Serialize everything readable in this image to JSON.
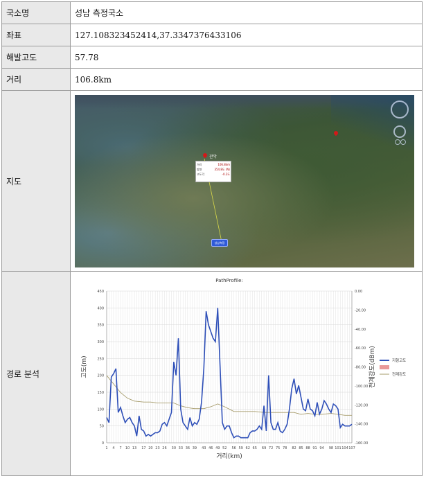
{
  "rows": {
    "station": {
      "label": "국소명",
      "value": "성남 측정국소"
    },
    "coords": {
      "label": "좌표",
      "value": "127.108323452414,37.3347376433106"
    },
    "altitude": {
      "label": "해발고도",
      "value": "57.78"
    },
    "distance": {
      "label": "거리",
      "value": "106.8km"
    },
    "map": {
      "label": "지도"
    },
    "path": {
      "label": "경로 분석"
    }
  },
  "map": {
    "infobox": [
      {
        "k": "거리",
        "v": "106.8km"
      },
      {
        "k": "방향",
        "v": "354.8도 (N)"
      },
      {
        "k": "고도각",
        "v": "-0.2도"
      }
    ],
    "pin_label": "관악",
    "marker_label": "성남측정"
  },
  "chart_data": {
    "type": "line",
    "title": "PathProfile:",
    "xlabel": "거리(km)",
    "ylabel_left": "고도(m)",
    "ylabel_right": "전계강도(dBm)",
    "ylim_left": [
      0,
      450
    ],
    "ylim_right": [
      -160,
      0
    ],
    "yticks_left": [
      "0",
      "50",
      "100",
      "150",
      "200",
      "250",
      "300",
      "350",
      "400",
      "450"
    ],
    "yticks_right": [
      "0.00",
      "-20.00",
      "-40.00",
      "-60.00",
      "-80.00",
      "-100.00",
      "-120.00",
      "-140.00",
      "-160.00"
    ],
    "xticks": [
      "1",
      "4",
      "7",
      "10",
      "13",
      "17",
      "20",
      "23",
      "26",
      "30",
      "33",
      "36",
      "39",
      "43",
      "46",
      "49",
      "52",
      "56",
      "59",
      "62",
      "65",
      "69",
      "72",
      "75",
      "78",
      "82",
      "85",
      "88",
      "91",
      "94",
      "98",
      "101",
      "104",
      "107"
    ],
    "grid": true,
    "legend_position": "right",
    "colors": {
      "terrain": "#2e4fb8",
      "field": "#a69b6a",
      "legend_box": "#e99999"
    },
    "series": [
      {
        "name": "지형고도",
        "x": [
          1,
          2,
          3,
          4,
          5,
          6,
          7,
          8,
          9,
          10,
          11,
          12,
          13,
          14,
          15,
          16,
          17,
          18,
          19,
          20,
          21,
          22,
          23,
          24,
          25,
          26,
          27,
          28,
          29,
          30,
          31,
          32,
          33,
          34,
          35,
          36,
          37,
          38,
          39,
          40,
          41,
          42,
          43,
          44,
          45,
          46,
          47,
          48,
          49,
          50,
          51,
          52,
          53,
          54,
          55,
          56,
          57,
          58,
          59,
          60,
          61,
          62,
          63,
          64,
          65,
          66,
          67,
          68,
          69,
          70,
          71,
          72,
          73,
          74,
          75,
          76,
          77,
          78,
          79,
          80,
          81,
          82,
          83,
          84,
          85,
          86,
          87,
          88,
          89,
          90,
          91,
          92,
          93,
          94,
          95,
          96,
          97,
          98,
          99,
          100,
          101,
          102,
          103,
          104,
          105,
          106,
          107
        ],
        "values": [
          75,
          60,
          195,
          205,
          220,
          90,
          105,
          80,
          60,
          70,
          75,
          60,
          50,
          20,
          80,
          40,
          35,
          20,
          25,
          20,
          25,
          30,
          30,
          35,
          55,
          60,
          50,
          70,
          90,
          240,
          200,
          310,
          100,
          60,
          50,
          40,
          75,
          50,
          60,
          55,
          70,
          120,
          220,
          390,
          350,
          330,
          310,
          300,
          400,
          230,
          60,
          40,
          50,
          50,
          30,
          15,
          20,
          20,
          15,
          15,
          15,
          15,
          30,
          35,
          35,
          40,
          50,
          40,
          110,
          35,
          200,
          60,
          40,
          40,
          60,
          35,
          30,
          40,
          55,
          100,
          160,
          190,
          145,
          170,
          135,
          100,
          95,
          130,
          100,
          95,
          80,
          120,
          85,
          100,
          125,
          115,
          100,
          90,
          115,
          110,
          100,
          45,
          55,
          50,
          50,
          50,
          55
        ]
      },
      {
        "name": "전계강도",
        "x": [
          1,
          4,
          7,
          10,
          13,
          17,
          20,
          23,
          26,
          30,
          33,
          36,
          39,
          43,
          46,
          49,
          52,
          56,
          59,
          62,
          65,
          69,
          72,
          75,
          78,
          82,
          85,
          88,
          91,
          94,
          98,
          101,
          104,
          107
        ],
        "values": [
          -89,
          -98,
          -107,
          -113,
          -116,
          -117,
          -117,
          -118,
          -118,
          -118,
          -121,
          -123,
          -124,
          -124,
          -122,
          -119,
          -122,
          -127,
          -127,
          -127,
          -127,
          -128,
          -128,
          -128,
          -128,
          -128,
          -130,
          -129,
          -130,
          -130,
          -129,
          -130,
          -131,
          -131
        ]
      }
    ]
  }
}
